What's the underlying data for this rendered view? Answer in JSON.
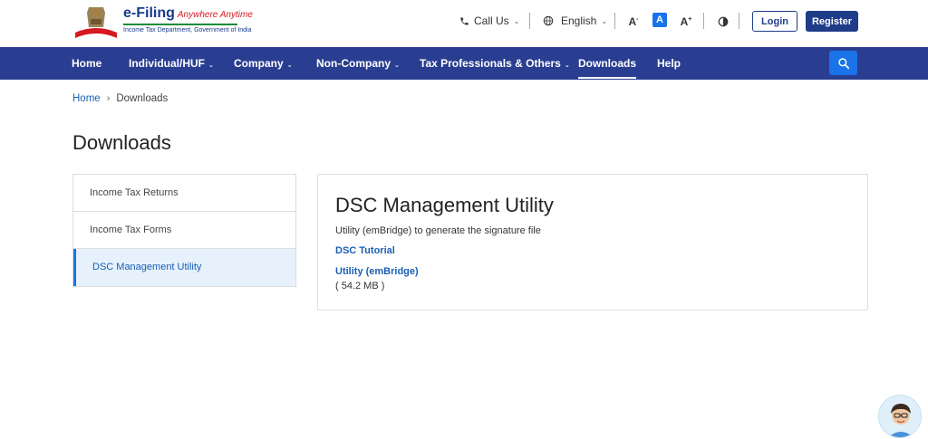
{
  "header": {
    "brand": "e-Filing",
    "tagline": "Anywhere Anytime",
    "subtitle": "Income Tax Department, Government of India",
    "call_us": "Call Us",
    "language": "English",
    "font_decrease": "A",
    "font_normal": "A",
    "font_increase": "A",
    "login": "Login",
    "register": "Register"
  },
  "nav": {
    "items": [
      {
        "label": "Home"
      },
      {
        "label": "Individual/HUF"
      },
      {
        "label": "Company"
      },
      {
        "label": "Non-Company"
      },
      {
        "label": "Tax Professionals & Others"
      },
      {
        "label": "Downloads"
      },
      {
        "label": "Help"
      }
    ]
  },
  "breadcrumb": {
    "home": "Home",
    "current": "Downloads"
  },
  "page": {
    "title": "Downloads"
  },
  "side_menu": {
    "items": [
      {
        "label": "Income Tax Returns"
      },
      {
        "label": "Income Tax Forms"
      },
      {
        "label": "DSC Management Utility"
      }
    ]
  },
  "content": {
    "title": "DSC Management Utility",
    "description": "Utility (emBridge) to generate the signature file",
    "tutorial_link": "DSC Tutorial",
    "utility_link": "Utility (emBridge)",
    "size": "( 54.2 MB )"
  },
  "colors": {
    "nav_bg": "#2a3e91",
    "primary": "#1f3c88",
    "accent": "#1a73e8",
    "link": "#1a5fb4"
  }
}
